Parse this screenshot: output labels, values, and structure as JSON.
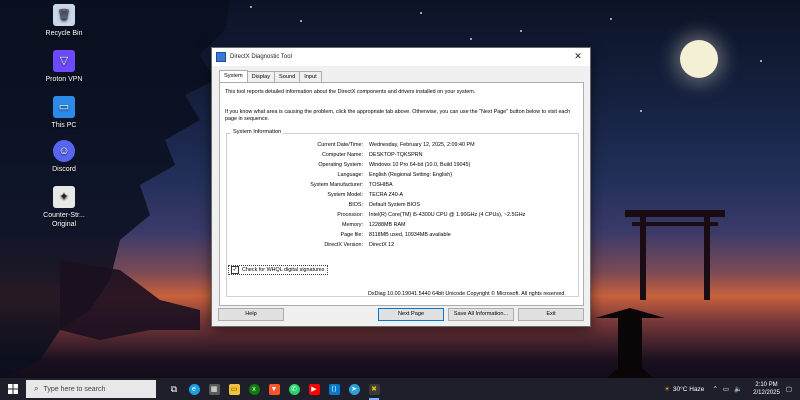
{
  "desktop_icons": [
    {
      "label": "Recycle Bin",
      "icon": "recycle-bin-icon"
    },
    {
      "label": "Proton VPN",
      "icon": "proton-vpn-icon"
    },
    {
      "label": "This PC",
      "icon": "this-pc-icon"
    },
    {
      "label": "Discord",
      "icon": "discord-icon"
    },
    {
      "label": "Counter-Str... Original",
      "icon": "counter-strike-icon"
    }
  ],
  "window": {
    "title": "DirectX Diagnostic Tool",
    "tabs": [
      "System",
      "Display",
      "Sound",
      "Input"
    ],
    "active_tab": "System",
    "intro1": "This tool reports detailed information about the DirectX components and drivers installed on your system.",
    "intro2": "If you know what area is causing the problem, click the appropriate tab above.  Otherwise, you can use the \"Next Page\" button below to visit each page in sequence.",
    "group_title": "System Information",
    "system_info": [
      {
        "label": "Current Date/Time:",
        "value": "Wednesday, February 12, 2025, 2:09:40 PM"
      },
      {
        "label": "Computer Name:",
        "value": "DESKTOP-TQKSPRN"
      },
      {
        "label": "Operating System:",
        "value": "Windows 10 Pro 64-bit (10.0, Build 19045)"
      },
      {
        "label": "Language:",
        "value": "English (Regional Setting: English)"
      },
      {
        "label": "System Manufacturer:",
        "value": "TOSHIBA"
      },
      {
        "label": "System Model:",
        "value": "TECRA Z40-A"
      },
      {
        "label": "BIOS:",
        "value": "Default System BIOS"
      },
      {
        "label": "Processor:",
        "value": "Intel(R) Core(TM) i5-4300U CPU @ 1.90GHz (4 CPUs), ~2.5GHz"
      },
      {
        "label": "Memory:",
        "value": "12288MB RAM"
      },
      {
        "label": "Page file:",
        "value": "8118MB used, 10934MB available"
      },
      {
        "label": "DirectX Version:",
        "value": "DirectX 12"
      }
    ],
    "whql_label": "Check for WHQL digital signatures",
    "whql_checked": "✓",
    "footer": "DxDiag 10.00.19041.5440 64bit Unicode  Copyright © Microsoft. All rights reserved.",
    "buttons": {
      "help": "Help",
      "next": "Next Page",
      "save": "Save All Information...",
      "exit": "Exit"
    }
  },
  "taskbar": {
    "search_placeholder": "Type here to search",
    "weather": "30°C  Haze",
    "time": "2:10 PM",
    "date": "2/12/2025"
  }
}
